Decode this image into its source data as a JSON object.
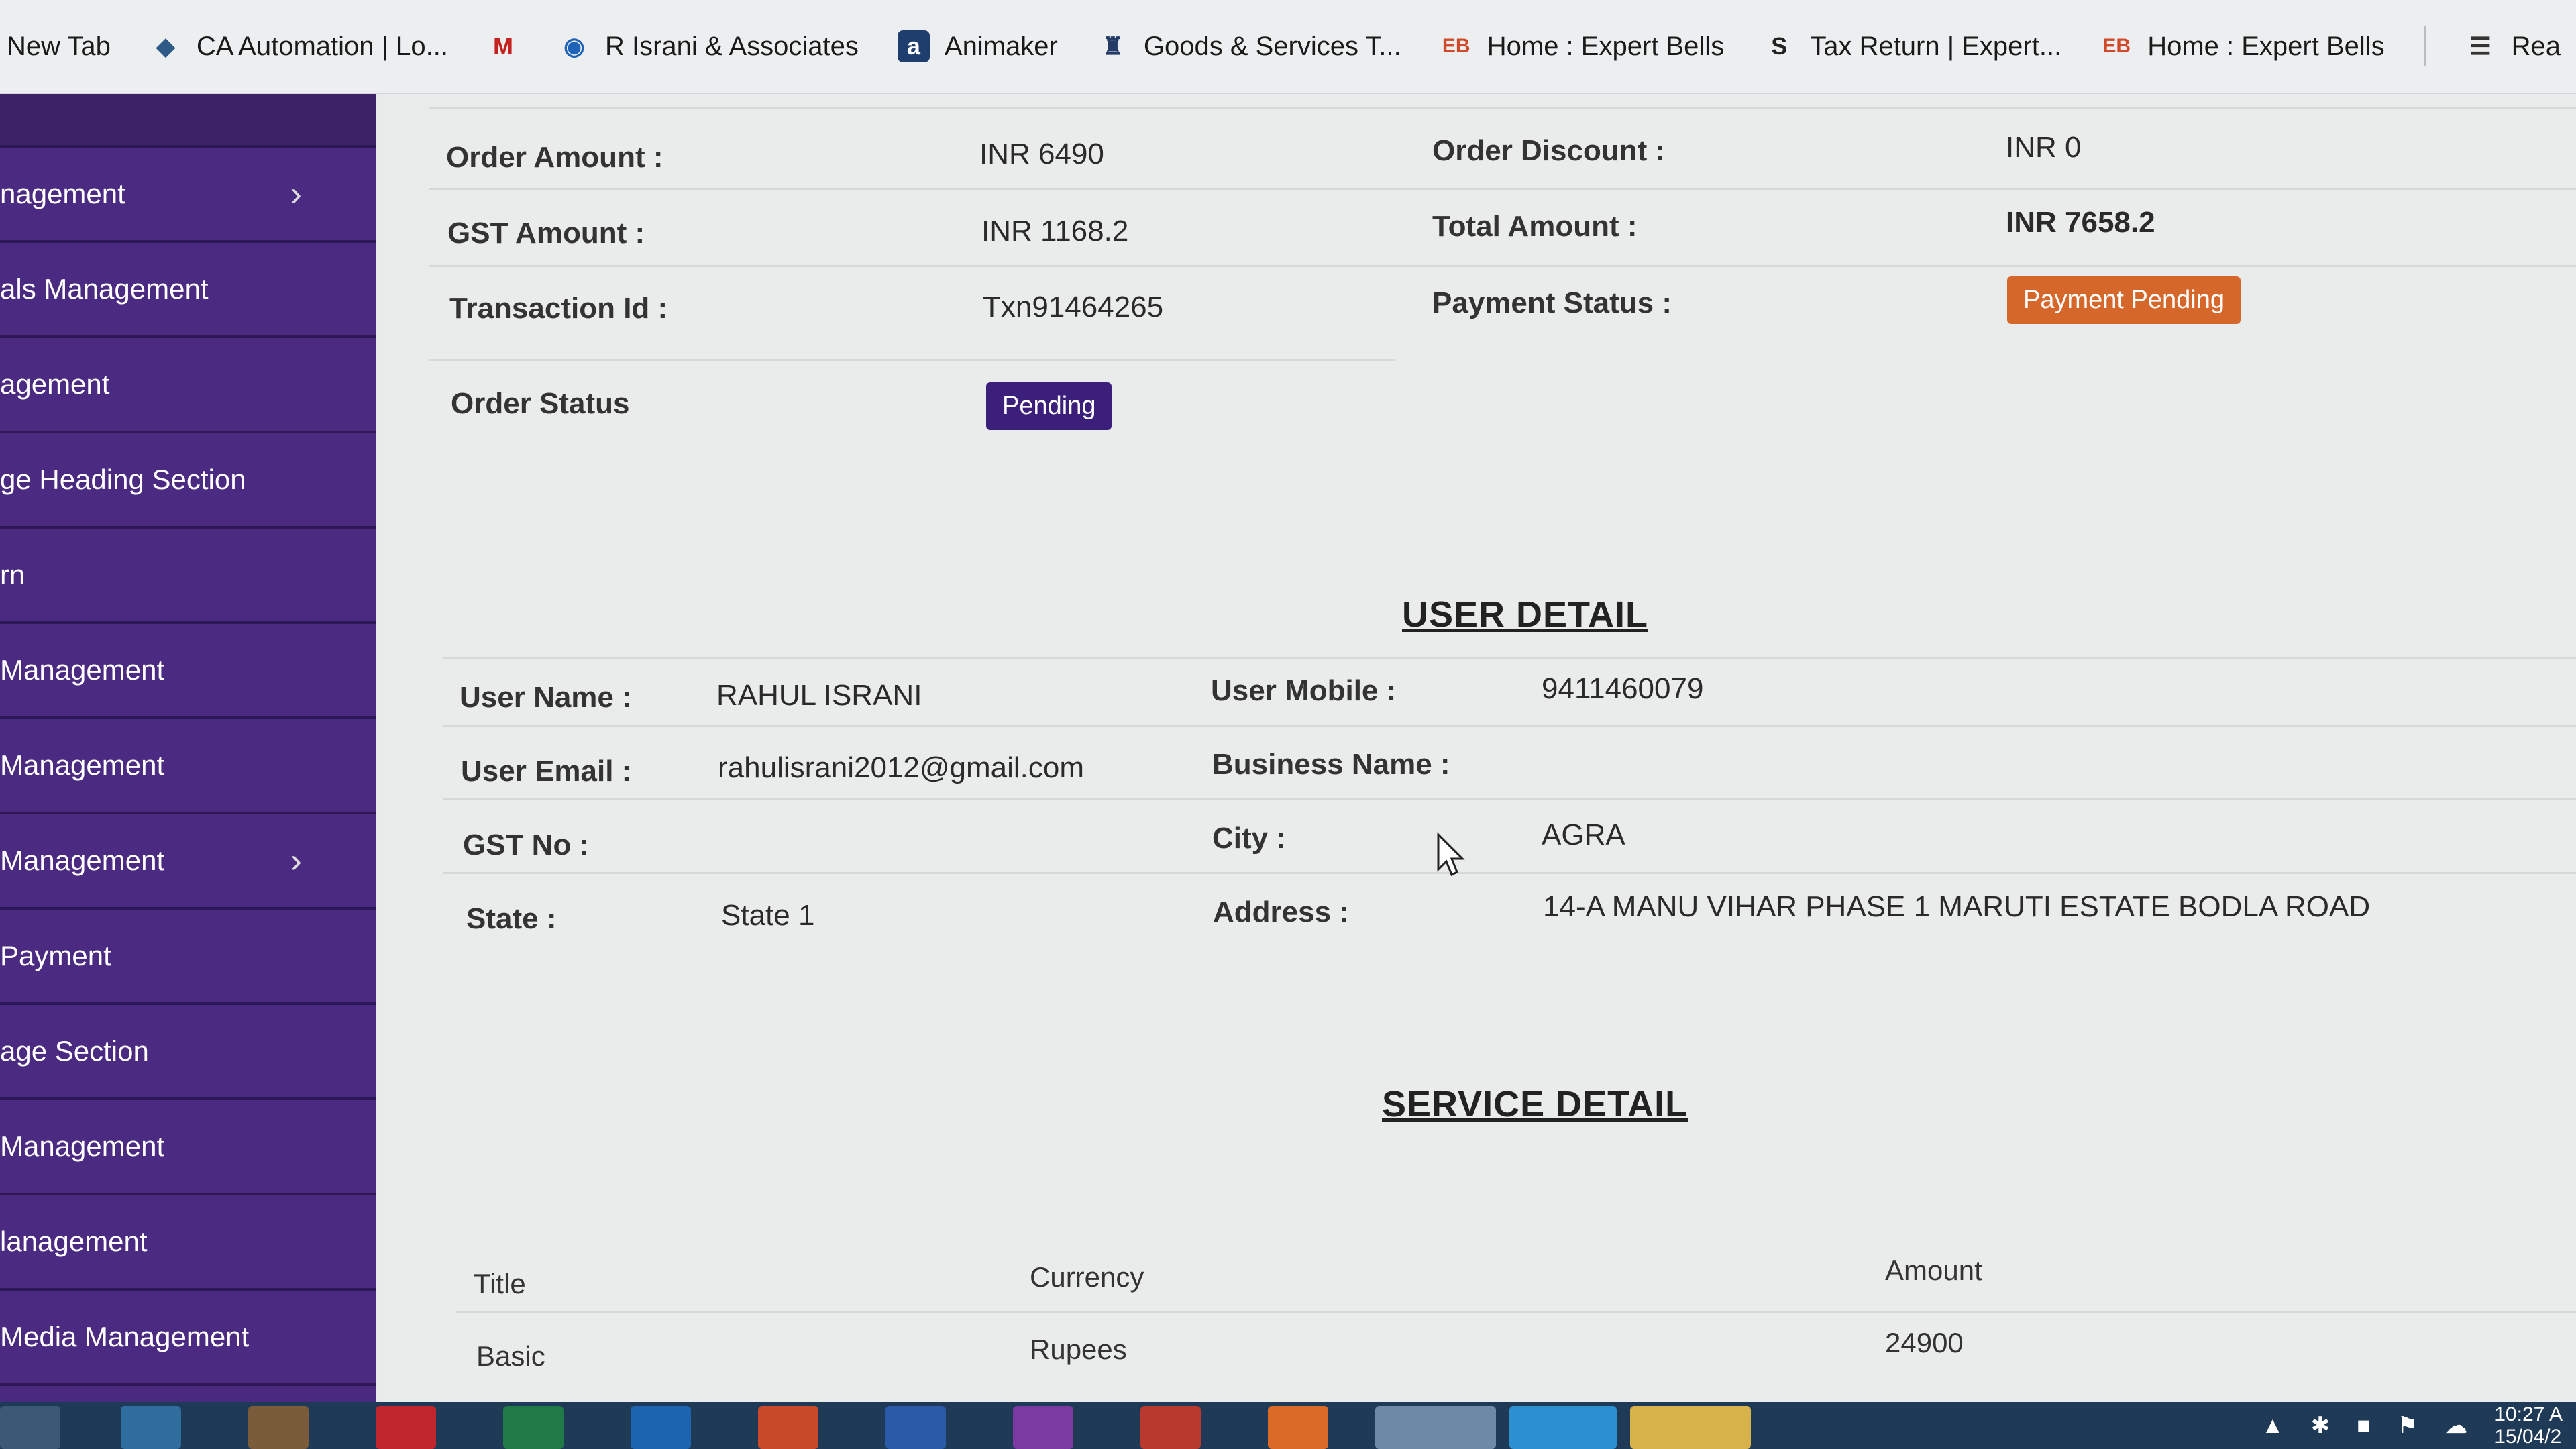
{
  "bookmarks": [
    {
      "label": "New Tab",
      "icon": "none"
    },
    {
      "label": "CA Automation | Lo...",
      "icon": "diamond-icon"
    },
    {
      "label": "",
      "icon": "gmail-icon"
    },
    {
      "label": "R Israni & Associates",
      "icon": "circle-icon"
    },
    {
      "label": "Animaker",
      "icon": "animaker-icon"
    },
    {
      "label": "Goods & Services T...",
      "icon": "emblem-icon"
    },
    {
      "label": "Home : Expert Bells",
      "icon": "eb-icon"
    },
    {
      "label": "Tax Return | Expert...",
      "icon": "s-icon"
    },
    {
      "label": "Home : Expert Bells",
      "icon": "eb-icon"
    },
    {
      "label": "Rea",
      "icon": "reading-list-icon"
    }
  ],
  "sidebar": {
    "items": [
      {
        "label": "nagement",
        "chevron": true
      },
      {
        "label": "als Management",
        "chevron": false
      },
      {
        "label": "agement",
        "chevron": false
      },
      {
        "label": "ge Heading Section",
        "chevron": false
      },
      {
        "label": "rn",
        "chevron": false
      },
      {
        "label": "Management",
        "chevron": false
      },
      {
        "label": "Management",
        "chevron": false
      },
      {
        "label": "Management",
        "chevron": true
      },
      {
        "label": "Payment",
        "chevron": false
      },
      {
        "label": "age Section",
        "chevron": false
      },
      {
        "label": "Management",
        "chevron": false
      },
      {
        "label": "lanagement",
        "chevron": false
      },
      {
        "label": "Media Management",
        "chevron": false
      }
    ]
  },
  "order": {
    "amount_label": "Order Amount :",
    "amount_value": "INR 6490",
    "discount_label": "Order Discount :",
    "discount_value": "INR 0",
    "gst_label": "GST Amount :",
    "gst_value": "INR 1168.2",
    "total_label": "Total Amount :",
    "total_value": "INR 7658.2",
    "txn_label": "Transaction Id :",
    "txn_value": "Txn91464265",
    "payment_status_label": "Payment Status :",
    "payment_status_value": "Payment Pending",
    "order_status_label": "Order Status",
    "order_status_value": "Pending"
  },
  "user_detail": {
    "title": "USER DETAIL",
    "name_label": "User Name :",
    "name_value": "RAHUL ISRANI",
    "mobile_label": "User Mobile :",
    "mobile_value": "9411460079",
    "email_label": "User Email :",
    "email_value": "rahulisrani2012@gmail.com",
    "business_label": "Business Name :",
    "business_value": "",
    "gst_label": "GST No :",
    "gst_value": "",
    "city_label": "City :",
    "city_value": "AGRA",
    "state_label": "State :",
    "state_value": "State 1",
    "address_label": "Address :",
    "address_value": "14-A MANU VIHAR PHASE 1 MARUTI ESTATE BODLA ROAD"
  },
  "service_detail": {
    "title": "SERVICE DETAIL",
    "columns": [
      "Title",
      "Currency",
      "Amount"
    ],
    "rows": [
      [
        "Basic",
        "Rupees",
        "24900"
      ]
    ]
  },
  "taskbar": {
    "clock_time": "10:27 A",
    "clock_date": "15/04/2"
  },
  "colors": {
    "sidebar": "#4b2a82",
    "pending_badge": "#3b1f7a",
    "payment_pending_badge": "#d6672a"
  }
}
